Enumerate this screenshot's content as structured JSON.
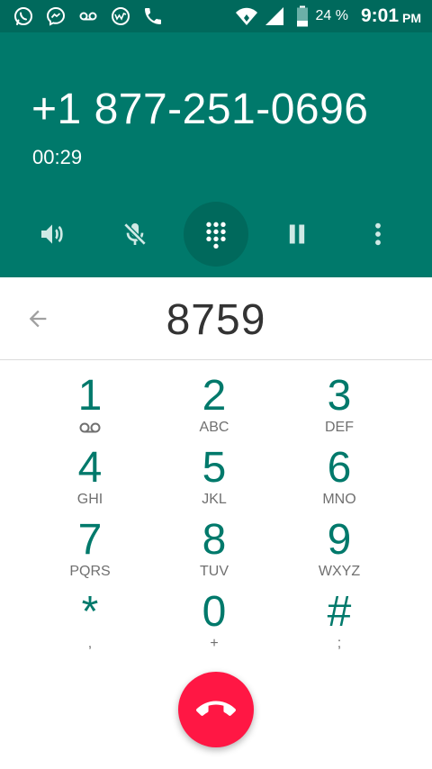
{
  "status_bar": {
    "notification_icons": [
      "whatsapp-icon",
      "messenger-icon",
      "voicemail-icon",
      "browser-icon",
      "phone-icon"
    ],
    "battery_percent": "24 %",
    "time": "9:01",
    "ampm": "PM"
  },
  "call": {
    "number": "+1 877-251-0696",
    "duration": "00:29"
  },
  "controls": {
    "icons": [
      "speaker-icon",
      "mute-mic-icon",
      "dialpad-icon",
      "pause-icon",
      "more-icon"
    ],
    "active": "dialpad"
  },
  "dialer": {
    "digits": "8759"
  },
  "keypad": {
    "keys": [
      {
        "digit": "1",
        "letters": ""
      },
      {
        "digit": "2",
        "letters": "ABC"
      },
      {
        "digit": "3",
        "letters": "DEF"
      },
      {
        "digit": "4",
        "letters": "GHI"
      },
      {
        "digit": "5",
        "letters": "JKL"
      },
      {
        "digit": "6",
        "letters": "MNO"
      },
      {
        "digit": "7",
        "letters": "PQRS"
      },
      {
        "digit": "8",
        "letters": "TUV"
      },
      {
        "digit": "9",
        "letters": "WXYZ"
      },
      {
        "digit": "*",
        "letters": ","
      },
      {
        "digit": "0",
        "letters": "+"
      },
      {
        "digit": "#",
        "letters": ";"
      }
    ]
  },
  "colors": {
    "status_bar": "#00695c",
    "header": "#00796b",
    "accent": "#00796b",
    "end_call": "#ff1744"
  }
}
